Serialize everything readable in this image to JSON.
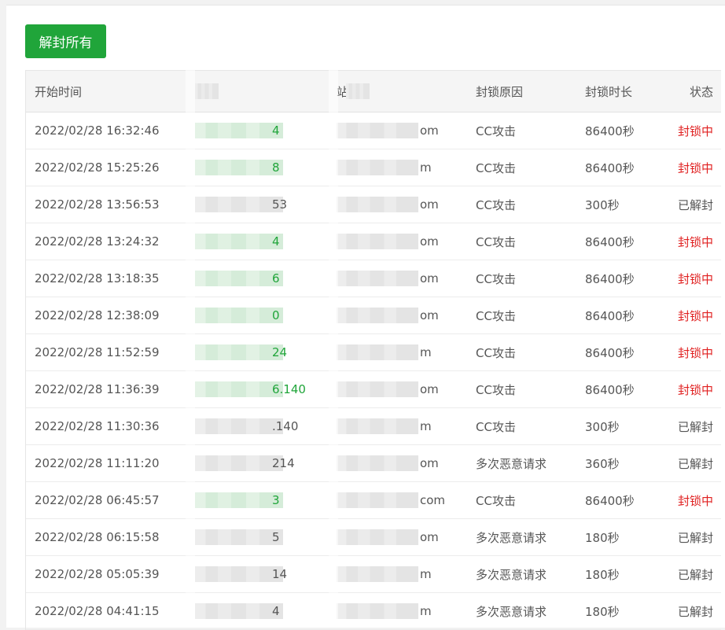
{
  "toolbar": {
    "unblock_all_label": "解封所有"
  },
  "table": {
    "columns": {
      "start_time": "开始时间",
      "site": "站",
      "reason": "封锁原因",
      "duration": "封锁时长",
      "status": "状态"
    },
    "rows": [
      {
        "time": "2022/02/28 16:32:46",
        "ip_tail": "4",
        "site_tail": "om",
        "reason": "CC攻击",
        "duration": "86400秒",
        "status": "封锁中",
        "blocked": true
      },
      {
        "time": "2022/02/28 15:25:26",
        "ip_tail": "8",
        "site_tail": "m",
        "reason": "CC攻击",
        "duration": "86400秒",
        "status": "封锁中",
        "blocked": true
      },
      {
        "time": "2022/02/28 13:56:53",
        "ip_tail": "53",
        "site_tail": "om",
        "reason": "CC攻击",
        "duration": "300秒",
        "status": "已解封",
        "blocked": false
      },
      {
        "time": "2022/02/28 13:24:32",
        "ip_tail": "4",
        "site_tail": "om",
        "reason": "CC攻击",
        "duration": "86400秒",
        "status": "封锁中",
        "blocked": true
      },
      {
        "time": "2022/02/28 13:18:35",
        "ip_tail": "6",
        "site_tail": "om",
        "reason": "CC攻击",
        "duration": "86400秒",
        "status": "封锁中",
        "blocked": true
      },
      {
        "time": "2022/02/28 12:38:09",
        "ip_tail": "0",
        "site_tail": "om",
        "reason": "CC攻击",
        "duration": "86400秒",
        "status": "封锁中",
        "blocked": true
      },
      {
        "time": "2022/02/28 11:52:59",
        "ip_tail": "24",
        "site_tail": "m",
        "reason": "CC攻击",
        "duration": "86400秒",
        "status": "封锁中",
        "blocked": true
      },
      {
        "time": "2022/02/28 11:36:39",
        "ip_tail": "6.140",
        "site_tail": "om",
        "reason": "CC攻击",
        "duration": "86400秒",
        "status": "封锁中",
        "blocked": true
      },
      {
        "time": "2022/02/28 11:30:36",
        "ip_tail": ".140",
        "site_tail": "m",
        "reason": "CC攻击",
        "duration": "300秒",
        "status": "已解封",
        "blocked": false
      },
      {
        "time": "2022/02/28 11:11:20",
        "ip_tail": "214",
        "site_tail": "om",
        "reason": "多次恶意请求",
        "duration": "360秒",
        "status": "已解封",
        "blocked": false
      },
      {
        "time": "2022/02/28 06:45:57",
        "ip_tail": "3",
        "site_tail": "com",
        "reason": "CC攻击",
        "duration": "86400秒",
        "status": "封锁中",
        "blocked": true
      },
      {
        "time": "2022/02/28 06:15:58",
        "ip_tail": "5",
        "site_tail": "om",
        "reason": "多次恶意请求",
        "duration": "180秒",
        "status": "已解封",
        "blocked": false
      },
      {
        "time": "2022/02/28 05:05:39",
        "ip_tail": "14",
        "site_tail": "m",
        "reason": "多次恶意请求",
        "duration": "180秒",
        "status": "已解封",
        "blocked": false
      },
      {
        "time": "2022/02/28 04:41:15",
        "ip_tail": "4",
        "site_tail": "m",
        "reason": "多次恶意请求",
        "duration": "180秒",
        "status": "已解封",
        "blocked": false
      }
    ]
  },
  "colors": {
    "accent": "#20a53a",
    "blocked": "#e02020"
  }
}
